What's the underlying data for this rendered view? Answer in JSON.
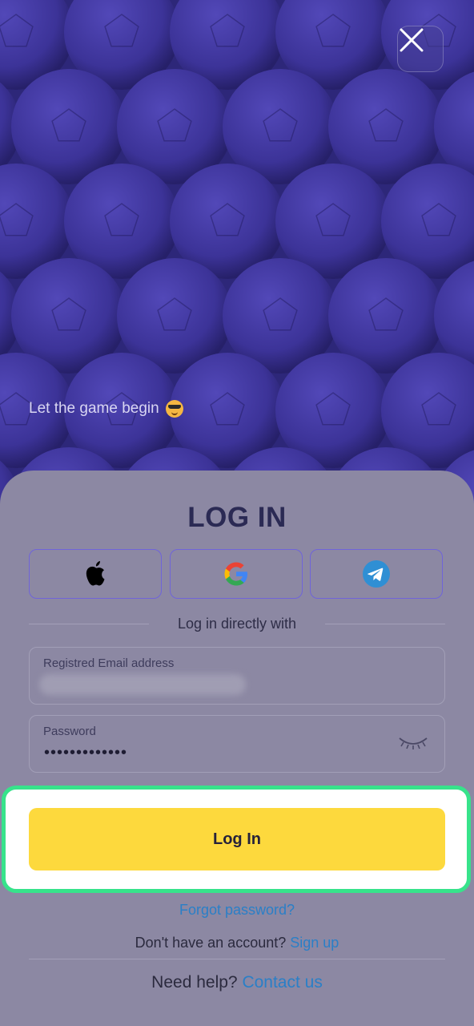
{
  "hero": {
    "tagline": "Let the game begin",
    "close_icon": "close-icon",
    "emoji_icon": "sunglasses-emoji-icon"
  },
  "login": {
    "title": "LOG IN",
    "social": [
      {
        "name": "apple-icon"
      },
      {
        "name": "google-icon"
      },
      {
        "name": "telegram-icon"
      }
    ],
    "divider_text": "Log in directly with",
    "email": {
      "label": "Registred Email address",
      "value": ""
    },
    "password": {
      "label": "Password",
      "value": "•••••••••••••",
      "toggle_icon": "eye-closed-icon"
    },
    "submit_label": "Log In",
    "forgot_label": "Forgot password?",
    "signup_prompt": "Don't have an account?",
    "signup_link": "Sign up",
    "help_prompt": "Need help?",
    "help_link": "Contact us"
  },
  "colors": {
    "accent_yellow": "#fdd93d",
    "link_blue": "#2a7fc7",
    "highlight_green": "#37e38b",
    "hero_purple": "#3a3392"
  }
}
